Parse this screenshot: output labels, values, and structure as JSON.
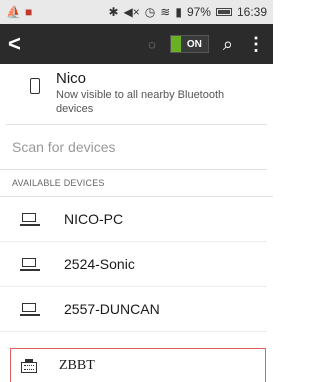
{
  "statusbar": {
    "left_icons": [
      "sailboat-icon",
      "app-icon"
    ],
    "battery": "97%",
    "time": "16:39"
  },
  "appbar": {
    "toggle_label": "ON",
    "accent": "#6ab023"
  },
  "self_device": {
    "name": "Nico",
    "status": "Now visible to all nearby Bluetooth devices"
  },
  "scan_label": "Scan for devices",
  "available_header": "AVAILABLE DEVICES",
  "devices": [
    {
      "name": "NICO-PC"
    },
    {
      "name": "2524-Sonic"
    },
    {
      "name": "2557-DUNCAN"
    }
  ],
  "highlighted_device": {
    "name": "ZBBT"
  }
}
